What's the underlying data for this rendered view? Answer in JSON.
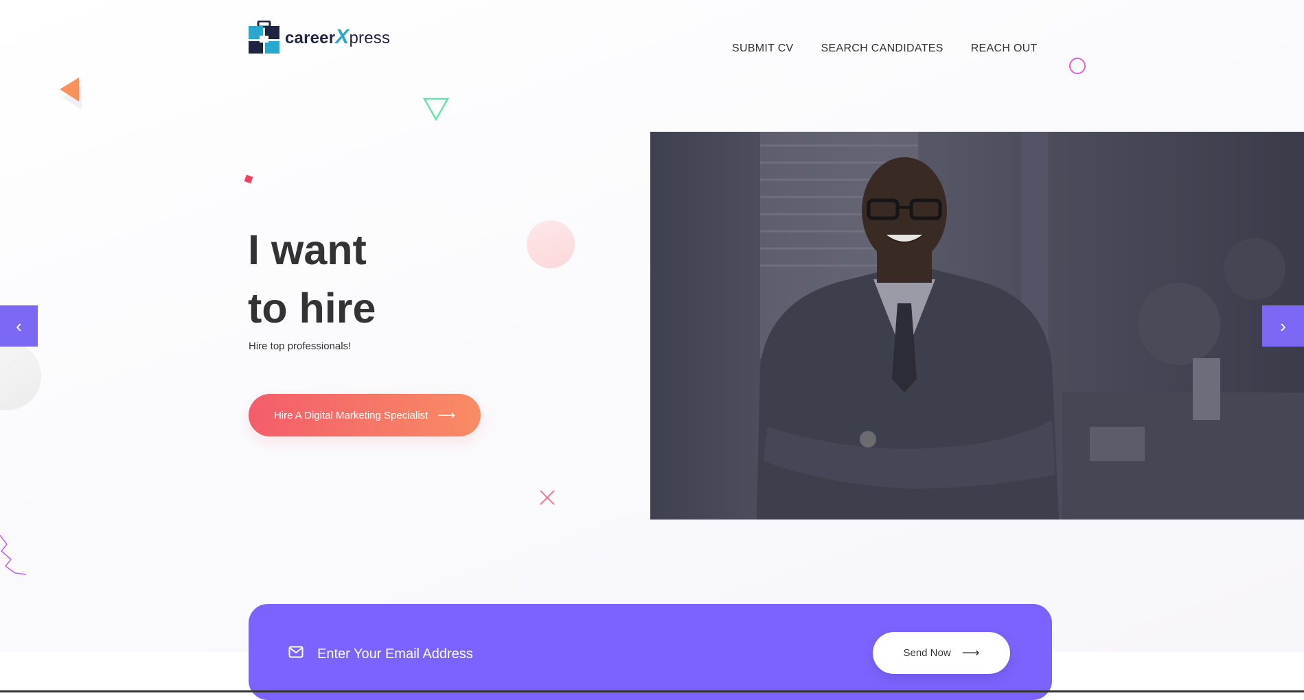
{
  "brand": {
    "name_bold": "career",
    "name_x": "X",
    "name_light": "press",
    "colors": {
      "dark": "#1f2440",
      "cyan": "#2aa7cf"
    }
  },
  "nav": {
    "items": [
      {
        "label": "SUBMIT CV"
      },
      {
        "label": "SEARCH CANDIDATES"
      },
      {
        "label": "REACH OUT"
      }
    ]
  },
  "hero": {
    "title_line1": "I want",
    "title_line2": "to hire",
    "subtitle": "Hire top professionals!",
    "cta_label": "Hire A Digital Marketing Specialist",
    "cta_arrow": "⟶",
    "prev_icon": "‹",
    "next_icon": "›"
  },
  "newsletter": {
    "email_placeholder": "Enter Your Email Address",
    "send_label": "Send Now",
    "send_arrow": "⟶",
    "colors": {
      "background": "#7c63ff"
    }
  },
  "theme": {
    "accent": "#7b68f5",
    "cta_gradient_start": "#f35d6a",
    "cta_gradient_end": "#f88c64"
  }
}
